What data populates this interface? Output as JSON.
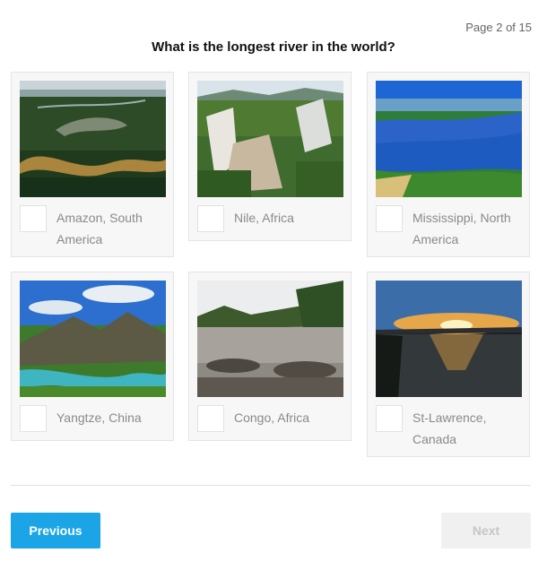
{
  "header": {
    "page_indicator": "Page 2 of 15",
    "question": "What is the longest river in the world?"
  },
  "options": [
    {
      "label": "Amazon, South America",
      "selected": false
    },
    {
      "label": "Nile, Africa",
      "selected": false
    },
    {
      "label": "Mississippi, North America",
      "selected": false
    },
    {
      "label": "Yangtze, China",
      "selected": false
    },
    {
      "label": "Congo, Africa",
      "selected": false
    },
    {
      "label": "St-Lawrence, Canada",
      "selected": false
    }
  ],
  "navigation": {
    "previous_label": "Previous",
    "next_label": "Next",
    "next_enabled": false
  },
  "colors": {
    "accent": "#1ca5e6",
    "card_background": "#f7f7f7",
    "option_text": "#8a8a8a"
  }
}
